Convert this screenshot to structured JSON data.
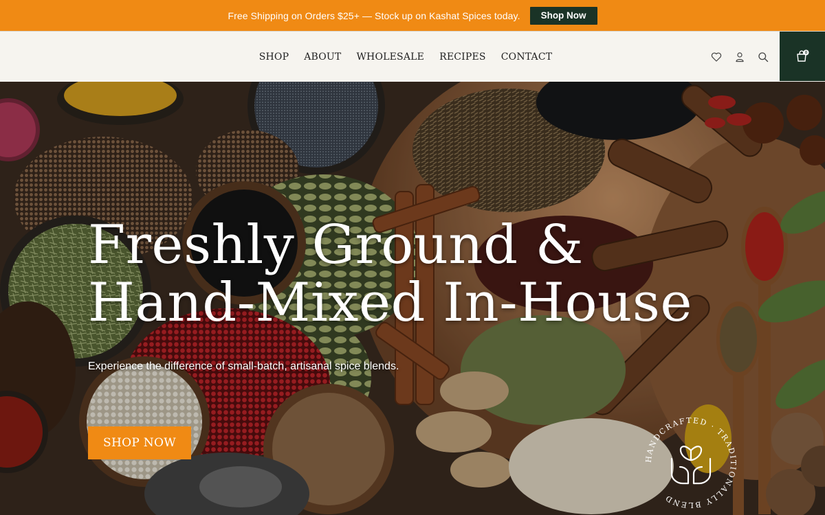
{
  "promo": {
    "text": "Free Shipping on Orders $25+ — Stock up on Kashat Spices today.",
    "button_label": "Shop Now"
  },
  "nav": {
    "items": [
      {
        "label": "SHOP"
      },
      {
        "label": "ABOUT"
      },
      {
        "label": "WHOLESALE"
      },
      {
        "label": "RECIPES"
      },
      {
        "label": "CONTACT"
      }
    ]
  },
  "header": {
    "icons": [
      "heart-icon",
      "account-icon",
      "search-icon",
      "cart-icon"
    ],
    "cart_count": "0"
  },
  "hero": {
    "title_line1": "Freshly Ground &",
    "title_line2": "Hand-Mixed In-House",
    "subtitle": "Experience the difference of small-batch, artisanal spice blends.",
    "button_label": "SHOP NOW",
    "seal_text": "HANDCRAFTED · TRADITIONALLY BLEND"
  },
  "colors": {
    "accent": "#f08a14",
    "dark_green": "#1a3326",
    "header_bg": "#f6f4ef"
  }
}
